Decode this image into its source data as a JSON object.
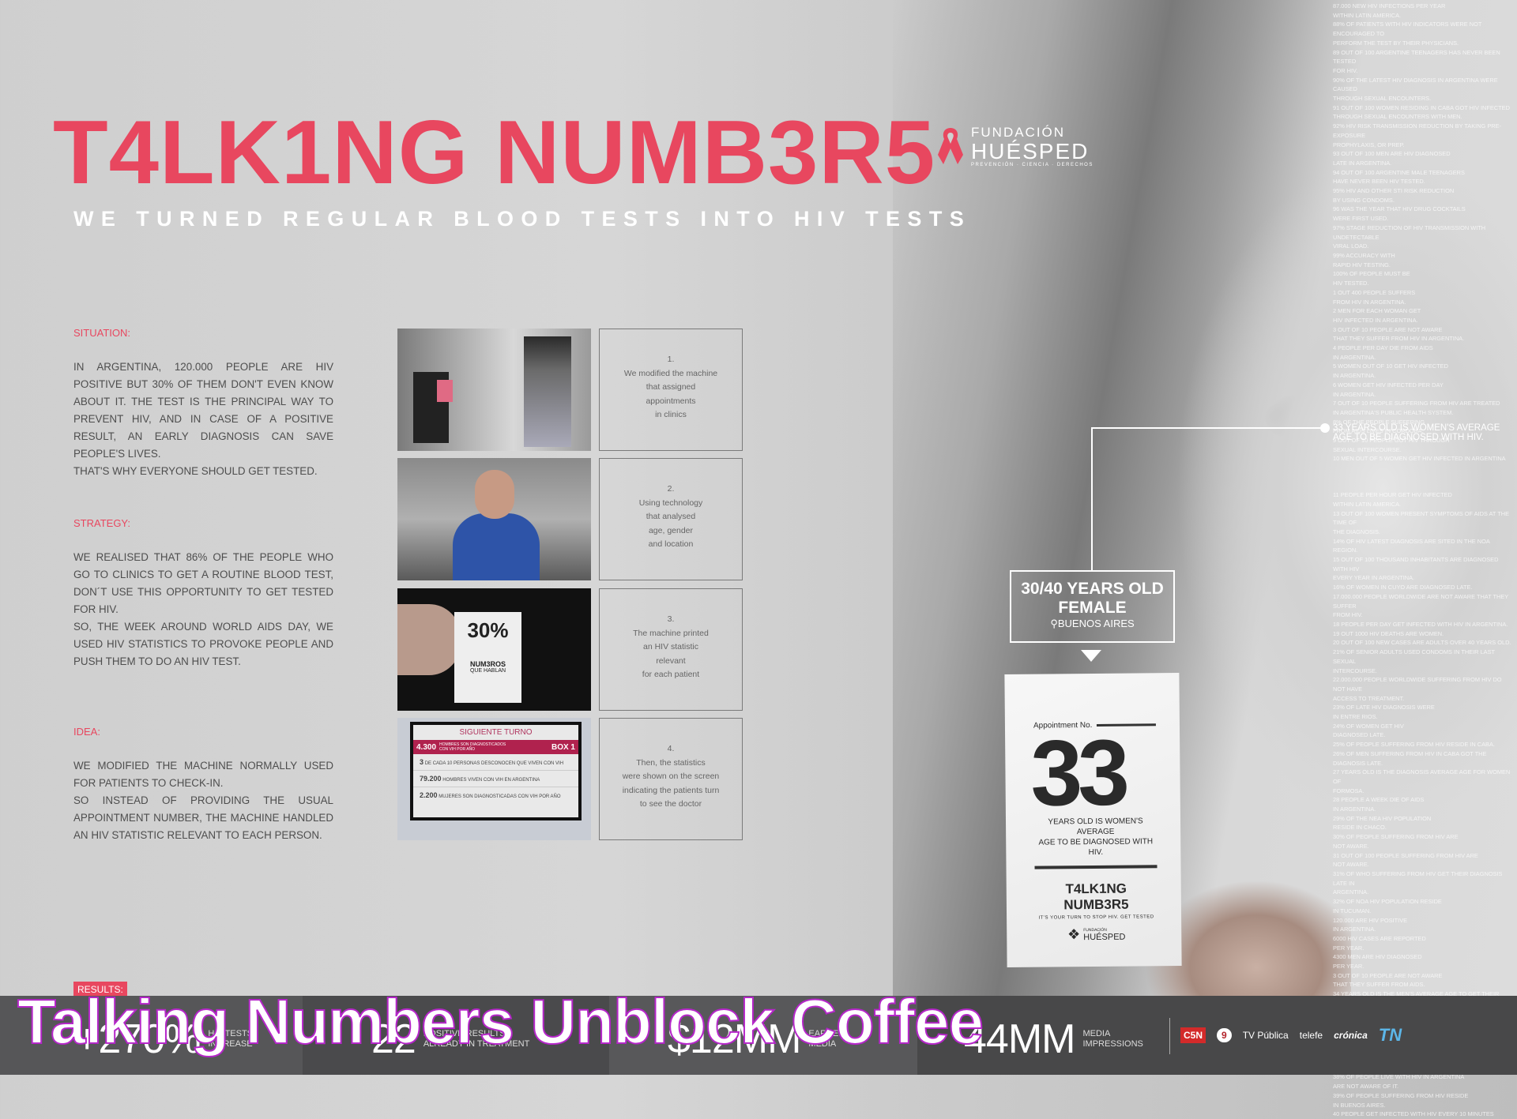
{
  "header": {
    "title": "T4LK1NG NUMB3R5",
    "subtitle": "WE TURNED REGULAR BLOOD TESTS INTO HIV TESTS"
  },
  "logo": {
    "line1": "FUNDACIÓN",
    "line2": "HUÉSPED",
    "tagline": "PREVENCIÓN · CIENCIA · DERECHOS",
    "icon": "ribbon-icon",
    "color": "#e8475f"
  },
  "sections": {
    "situation": {
      "heading": "SITUATION:",
      "paragraphs": [
        "IN ARGENTINA, 120.000 PEOPLE ARE HIV POSITIVE BUT 30% OF THEM DON'T EVEN KNOW ABOUT IT. THE TEST IS THE PRINCIPAL WAY TO PREVENT HIV, AND IN CASE OF A POSITIVE RESULT, AN EARLY DIAGNOSIS CAN SAVE PEOPLE'S LIVES.",
        "THAT'S WHY EVERYONE SHOULD GET TESTED."
      ]
    },
    "strategy": {
      "heading": "STRATEGY:",
      "paragraphs": [
        "WE REALISED THAT 86% OF THE PEOPLE WHO GO TO CLINICS TO GET A ROUTINE BLOOD TEST, DON´T USE THIS OPPORTUNITY TO GET TESTED FOR HIV.",
        "SO, THE WEEK AROUND WORLD AIDS DAY, WE USED HIV STATISTICS TO PROVOKE PEOPLE AND PUSH THEM TO DO AN HIV TEST."
      ]
    },
    "idea": {
      "heading": "IDEA:",
      "paragraphs": [
        "WE MODIFIED THE MACHINE NORMALLY USED FOR PATIENTS TO CHECK-IN.",
        "SO INSTEAD OF PROVIDING THE USUAL APPOINTMENT NUMBER, THE MACHINE HANDLED AN HIV STATISTIC RELEVANT TO EACH PERSON."
      ]
    },
    "results": {
      "heading": "RESULTS:"
    }
  },
  "steps": [
    {
      "n": "1.",
      "lines": [
        "We modified the machine",
        "that assigned",
        "appointments",
        "in clinics"
      ]
    },
    {
      "n": "2.",
      "lines": [
        "Using technology",
        "that analysed",
        "age, gender",
        "and location"
      ]
    },
    {
      "n": "3.",
      "lines": [
        "The machine printed",
        "an HIV statistic",
        "relevant",
        "for each patient"
      ]
    },
    {
      "n": "4.",
      "lines": [
        "Then, the statistics",
        "were shown on the screen",
        "indicating the patients turn",
        "to see the doctor"
      ]
    }
  ],
  "photos": {
    "ticket": {
      "big": "30%",
      "small1": "NUM3ROS",
      "small2": "QUE HABLAN"
    },
    "screen": {
      "title": "SIGUIENTE TURNO",
      "main_num": "4.300",
      "main_text": "HOMBRES SON DIAGNOSTICADOS CON VIH POR AÑO",
      "box": "BOX 1",
      "rows": [
        {
          "num": "3",
          "text": "DE CADA 10 PERSONAS DESCONOCEN QUE VIVEN CON VIH"
        },
        {
          "num": "79.200",
          "text": "HOMBRES VIVEN CON VIH EN ARGENTINA"
        },
        {
          "num": "2.200",
          "text": "MUJERES SON DIAGNOSTICADAS CON VIH POR AÑO"
        }
      ]
    }
  },
  "stats_column": {
    "before": [
      "87.000 NEW HIV INFECTIONS PER YEAR",
      "WITHIN LATIN AMERICA.",
      "88% OF PATIENTS WITH HIV INDICATORS WERE NOT ENCOURAGED TO",
      "PERFORM THE TEST BY THEIR PHYSICIANS.",
      "89 OUT OF 100 ARGENTINE TEENAGERS HAS NEVER BEEN TESTED",
      "FOR HIV.",
      "90% OF THE LATEST HIV DIAGNOSIS IN ARGENTINA WERE CAUSED",
      "THROUGH SEXUAL ENCOUNTERS.",
      "91 OUT OF 100 WOMEN RESIDING IN CABA GOT HIV INFECTED",
      "THROUGH SEXUAL ENCOUNTERS WITH MEN.",
      "92% HIV RISK TRANSMISSION REDUCTION BY TAKING PRE-EXPOSURE",
      "PROPHYLAXIS, OR PREP.",
      "93 OUT OF 100 MEN ARE HIV DIAGNOSED",
      "LATE IN ARGENTINA.",
      "94 OUT OF 100 ARGENTINE MALE TEENAGERS",
      "HAVE NEVER BEEN HIV TESTED.",
      "95% HIV AND OTHER STI RISK REDUCTION",
      "BY USING CONDOMS.",
      "96 WAS THE YEAR THAT HIV DRUG COCKTAILS",
      "WERE FIRST USED.",
      "97% STAGE REDUCTION OF HIV TRANSMISSION WITH UNDETECTABLE",
      "VIRAL LOAD.",
      "99% ACCURACY WITH",
      "RAPID HIV TESTING.",
      "100% OF PEOPLE MUST BE",
      "HIV TESTED.",
      "1 OUT 400 PEOPLE SUFFERS",
      "FROM HIV IN ARGENTINA.",
      "2 MEN FOR EACH WOMAN GET",
      "HIV INFECTED IN ARGENTINA.",
      "3 OUT OF 10 PEOPLE ARE NOT AWARE",
      "THAT THEY SUFFER FROM HIV IN ARGENTINA.",
      "4 PEOPLE PER DAY DIE FROM AIDS",
      "IN ARGENTINA.",
      "5 WOMEN OUT OF 10 GET HIV INFECTED",
      "IN ARGENTINA.",
      "6 WOMEN GET HIV INFECTED PER DAY",
      "IN ARGENTINA.",
      "7 OUT OF 10 PEOPLE SUFFERING FROM HIV ARE TREATED",
      "IN ARGENTINA'S PUBLIC HEALTH SYSTEM.",
      "8% OF THE PEOPLE SUFFERING",
      "FROM AIDS LIVES IN CORDOBA.",
      "9 OUT OF 10 PEOPLE GOT HIV THROUGH",
      "SEXUAL INTERCOURSE.",
      "10 MEN OUT OF 5 WOMEN GET HIV INFECTED IN ARGENTINA"
    ],
    "highlight": "33 YEARS OLD IS WOMEN'S AVERAGE AGE TO BE DIAGNOSED WITH HIV.",
    "after": [
      "11 PEOPLE PER HOUR GET HIV INFECTED",
      "WITHIN LATIN AMERICA.",
      "13 OUT OF 100 WOMEN PRESENT SYMPTOMS OF AIDS AT THE TIME OF",
      "THE DIAGNOSIS.",
      "14% OF HIV LATEST DIAGNOSIS ARE SITED IN THE NOA REGION.",
      "15 OUT OF 100 THOUSAND INHABITANTS ARE DIAGNOSED WITH HIV",
      "EVERY YEAR IN ARGENTINA.",
      "16% OF WOMEN IN CUYO ARE DIAGNOSED LATE.",
      "17.000.000 PEOPLE WORLDWIDE ARE NOT AWARE THAT THEY SUFFER",
      "FROM HIV.",
      "18 PEOPLE PER DAY GET INFECTED WITH HIV IN ARGENTINA.",
      "19 OUT 1000 HIV DEATHS ARE WOMEN.",
      "20 OUT OF 100 NEW CASES ARE ADULTS OVER 40 YEARS OLD.",
      "21% OF SENIOR ADULTS USED CONDOMS IN THEIR LAST SEXUAL",
      "INTERCOURSE.",
      "22.000.000 PEOPLE WORLDWIDE SUFFERING FROM HIV DO NOT HAVE",
      "ACCESS TO TREATMENT.",
      "23% OF LATE HIV DIAGNOSIS WERE",
      "IN ENTRE RIOS.",
      "24% OF WOMEN GET HIV",
      "DIAGNOSED LATE.",
      "25% OF PEOPLE SUFFERING FROM HIV RESIDE IN CABA.",
      "26% OF MEN SUFFERING FROM HIV IN CABA GOT THE",
      "DIAGNOSIS LATE.",
      "27 YEARS OLD IS THE DIAGNOSIS AVERAGE AGE FOR WOMEN OF",
      "FORMOSA.",
      "28 PEOPLE A WEEK DIE OF AIDS",
      "IN ARGENTINA.",
      "29% OF THE NEA HIV POPULATION",
      "RESIDE IN CHACO.",
      "30% OF PEOPLE SUFFERING FROM HIV ARE",
      "NOT AWARE.",
      "31 OUT OF 100 PEOPLE SUFFERING FROM HIV ARE",
      "NOT AWARE.",
      "31% OF WHO SUFFERING FROM HIV GET THEIR DIAGNOSIS LATE IN",
      "ARGENTINA.",
      "32% OF NOA HIV POPULATION RESIDE",
      "IN TUCUMAN.",
      "120.000 ARE HIV POSITIVE",
      "IN ARGENTINA.",
      "6000 HIV CASES ARE REPORTED",
      "PER YEAR.",
      "4300 MEN ARE HIV DIAGNOSED",
      "PER YEAR.",
      "3 OUT OF 10 PEOPLE ARE NOT AWARE",
      "THAT THEY SUFFER FROM AIDS.",
      "34 YEARS OLD IS THE MEN'S AVERAGE AGE TO GET THEIR",
      "HIV DIAGNOSIS.",
      "35.000.000 PEOPLE HAVE DIED SINCE THE OUTBREAK FROM AIDS",
      "WORLDWIDE.",
      "1 PEOPLE GET HIV EVERY 12 HOURS",
      "IN ARGENTINA.",
      "37.000.000 PEOPLE LIVE WITH HIV",
      "WORLDWIDE.",
      "38% OF PEOPLE LIVE WITH HIV IN ARGENTINA",
      "ARE NOT AWARE OF IT.",
      "39% OF PEOPLE SUFFERING FROM HIV RESIDE",
      "IN BUENOS AIRES.",
      "40 PEOPLE GET INFECTED WITH HIV EVERY 10 MINUTES"
    ]
  },
  "target": {
    "line1": "30/40 YEARS OLD",
    "line2": "FEMALE",
    "location": "BUENOS AIRES",
    "location_icon": "map-pin-icon"
  },
  "card": {
    "label": "Appointment No.",
    "number": "33",
    "text1": "YEARS OLD IS WOMEN'S AVERAGE",
    "text2": "AGE TO BE DIAGNOSED WITH HIV.",
    "brand": "T4LK1NG NUMB3R5",
    "slogan": "IT'S YOUR TURN TO STOP HIV. GET TESTED",
    "logo_small1": "FUNDACIÓN",
    "logo_small2": "HUÉSPED"
  },
  "results": [
    {
      "num": "+270%",
      "label1": "HIV TESTS",
      "label2": "INCREASE"
    },
    {
      "num": "22",
      "label1": "POSITIVE RESULTS",
      "label2": "ALREADY IN TREATMENT"
    },
    {
      "num": "$12MM",
      "label1": "EARNED",
      "label2": "MEDIA"
    },
    {
      "num": "44MM",
      "label1": "MEDIA",
      "label2": "IMPRESSIONS"
    }
  ],
  "media_logos": [
    "C5N",
    "9",
    "TV Pública",
    "telefe",
    "crónica",
    "TN"
  ],
  "overlay_title": "Talking Numbers Unblock Coffee",
  "colors": {
    "accent": "#e8475f",
    "overlay_stroke": "#b526c9",
    "bar": "#4a4a4c"
  }
}
